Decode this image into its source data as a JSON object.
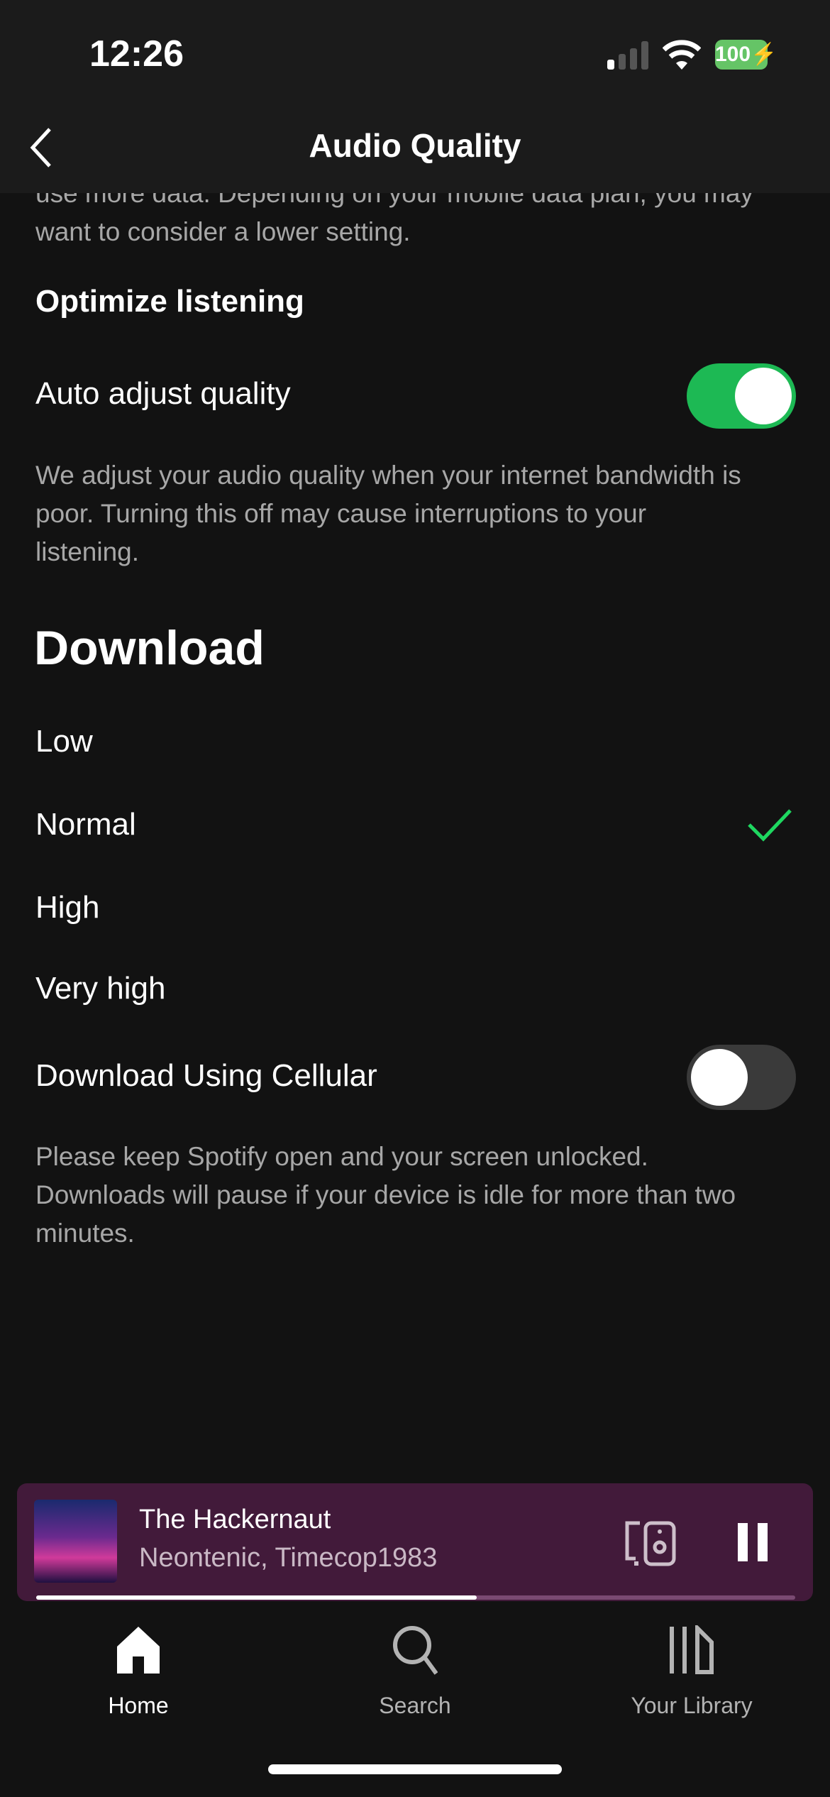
{
  "status_bar": {
    "time": "12:26",
    "battery": "100",
    "battery_color": "#65c466"
  },
  "header": {
    "title": "Audio Quality"
  },
  "intro_partial": [
    "use more data. Depending on your mobile data plan, you may",
    "want to consider a lower setting."
  ],
  "optimize": {
    "heading": "Optimize listening",
    "auto_adjust_label": "Auto adjust quality",
    "auto_adjust_on": true,
    "description": [
      "We adjust your audio quality when your internet bandwidth is",
      "poor. Turning this off may cause interruptions to your",
      "listening."
    ]
  },
  "download": {
    "heading": "Download",
    "options": [
      "Low",
      "Normal",
      "High",
      "Very high"
    ],
    "selected": "Normal",
    "cellular_label": "Download Using Cellular",
    "cellular_on": false,
    "description": [
      "Please keep Spotify open and your screen unlocked.",
      "Downloads will pause if your device is idle for more than two",
      "minutes."
    ]
  },
  "player": {
    "track": "The Hackernaut",
    "artists": "Neontenic, Timecop1983",
    "progress_percent": 58,
    "bg_color": "#421a3a"
  },
  "tabs": [
    {
      "label": "Home",
      "icon": "home-icon",
      "active": true
    },
    {
      "label": "Search",
      "icon": "search-icon",
      "active": false
    },
    {
      "label": "Your Library",
      "icon": "library-icon",
      "active": false
    }
  ],
  "accent": "#1ed760"
}
